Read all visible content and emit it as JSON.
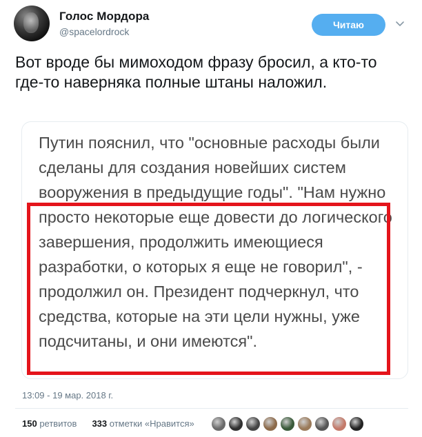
{
  "user": {
    "display_name": "Голос Мордора",
    "handle": "@spacelordrock",
    "follow_label": "Читаю"
  },
  "tweet": {
    "text": "Вот вроде бы мимоходом фразу бросил, а кто-то где-то наверняка полные штаны наложил."
  },
  "media": {
    "paragraph_1": "Путин пояснил, что \"основные расходы были сделаны для создания новейших систем вооружения в предыдущие годы\".",
    "paragraph_2": "\"Нам нужно просто некоторые еще довести до логического завершения, продолжить имеющиеся разработки, о которых я еще не говорил\", - продолжил он. Президент подчеркнул, что средства, которые на эти цели нужны, уже подсчитаны, и они имеются\".",
    "highlight_color": "#e4141b"
  },
  "meta": {
    "timestamp": "13:09 - 19 мар. 2018 г.",
    "retweets_count": "150",
    "retweets_label": "ретвитов",
    "likes_count": "333",
    "likes_label": "отметки «Нравится»"
  },
  "likers": [
    {
      "icon": "avatar-1",
      "color": "#6b6b6b"
    },
    {
      "icon": "avatar-2",
      "color": "#2f2f2f"
    },
    {
      "icon": "avatar-3",
      "color": "#444444"
    },
    {
      "icon": "avatar-4",
      "color": "#8c6a4a"
    },
    {
      "icon": "avatar-5",
      "color": "#3a5a3a"
    },
    {
      "icon": "avatar-6",
      "color": "#9a7a5a"
    },
    {
      "icon": "avatar-7",
      "color": "#555555"
    },
    {
      "icon": "avatar-8",
      "color": "#c47a6a"
    },
    {
      "icon": "avatar-9",
      "color": "#222222"
    }
  ],
  "colors": {
    "accent": "#55aef0",
    "muted": "#657786",
    "text": "#14171a"
  }
}
